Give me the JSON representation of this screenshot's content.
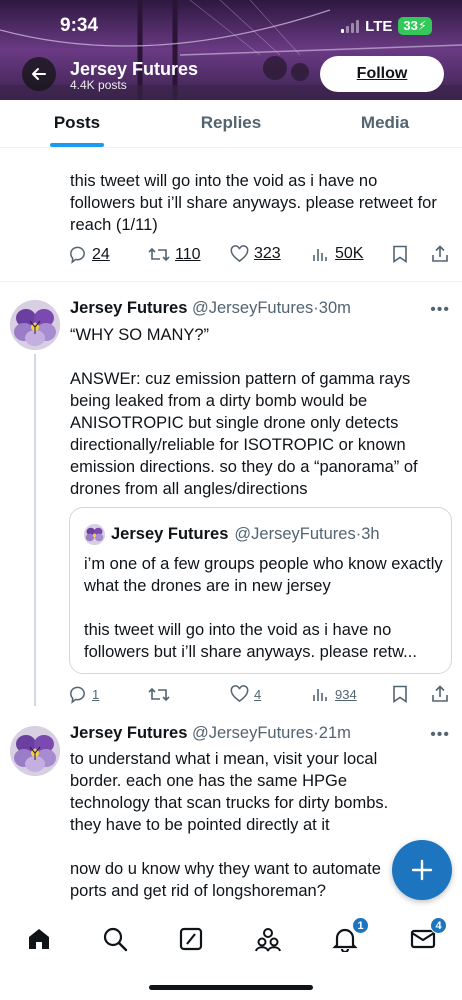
{
  "status": {
    "time": "9:34",
    "network": "LTE",
    "battery": "33"
  },
  "profile": {
    "name": "Jersey Futures",
    "posts_count": "4.4K posts",
    "follow_label": "Follow"
  },
  "tabs": [
    {
      "label": "Posts"
    },
    {
      "label": "Replies"
    },
    {
      "label": "Media"
    }
  ],
  "tweet1": {
    "text": "this tweet will go into the void as i have no followers but i’ll share anyways. please retweet for reach (1/11)",
    "replies": "24",
    "retweets": "110",
    "likes": "323",
    "views": "50K"
  },
  "tweet2": {
    "name": "Jersey Futures",
    "handle": "@JerseyFutures",
    "time": "30m",
    "text_line1": "“WHY SO MANY?”",
    "text_body": "ANSWEr: cuz emission pattern of gamma rays being leaked from a dirty bomb would be ANISOTROPIC but single drone only detects directionally/reliable for ISOTROPIC or known emission directions. so they do a “panorama” of drones from all angles/directions",
    "quote": {
      "name": "Jersey Futures",
      "handle": "@JerseyFutures",
      "time": "3h",
      "text_line1": "i’m one of a few groups people who know exactly what the drones are in new jersey",
      "text_line2": "this tweet will go into the void as i have no followers but i’ll share anyways. please retw..."
    },
    "replies": "1",
    "retweets": "",
    "likes": "4",
    "views": "934"
  },
  "tweet3": {
    "name": "Jersey Futures",
    "handle": "@JerseyFutures",
    "time": "21m",
    "text_line1": "to understand what i mean, visit your local border. each one has the same HPGe technology that scan trucks for dirty bombs. they have to be pointed directly at it",
    "text_line2": "now do u know why they want to automate ports and get rid of longshoreman?"
  },
  "nav": {
    "notifications_badge": "1",
    "messages_badge": "4"
  },
  "colors": {
    "accent": "#1d9bf0",
    "fab": "#1d75c0",
    "text": "#0f1419",
    "muted": "#536471"
  }
}
